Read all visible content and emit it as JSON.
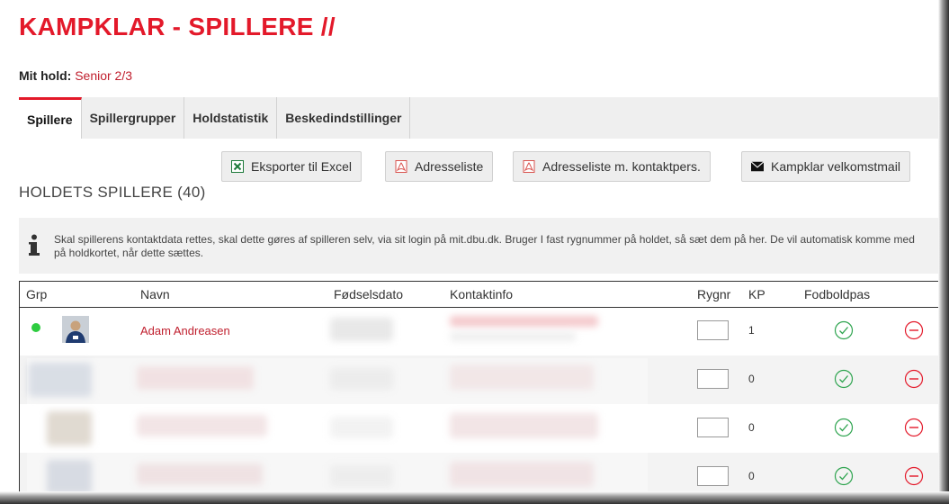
{
  "page_title": "KAMPKLAR - SPILLERE //",
  "my_team": {
    "label": "Mit hold:",
    "value": "Senior 2/3"
  },
  "tabs": [
    {
      "label": "Spillere",
      "active": true
    },
    {
      "label": "Spillergrupper",
      "active": false
    },
    {
      "label": "Holdstatistik",
      "active": false
    },
    {
      "label": "Beskedindstillinger",
      "active": false
    }
  ],
  "actions": {
    "export_excel": {
      "label": "Eksporter til Excel",
      "icon": "excel-icon"
    },
    "address_list": {
      "label": "Adresseliste",
      "icon": "pdf-icon"
    },
    "address_list_contacts": {
      "label": "Adresseliste m. kontaktpers.",
      "icon": "pdf-icon"
    },
    "welcome_mail": {
      "label": "Kampklar velkomstmail",
      "icon": "envelope-icon"
    }
  },
  "section_title": "HOLDETS SPILLERE (40)",
  "info_text": "Skal spillerens kontaktdata rettes, skal dette gøres af spilleren selv, via sit login på mit.dbu.dk. Bruger I fast rygnummer på holdet, så sæt dem på her. De vil automatisk komme med på holdkortet, når dette sættes.",
  "table": {
    "headers": [
      "Grp",
      "Navn",
      "Fødselsdato",
      "Kontaktinfo",
      "Rygnr",
      "KP",
      "Fodboldpas"
    ],
    "rows": [
      {
        "name": "Adam Andreasen",
        "kp": "1",
        "group_active": true
      },
      {
        "name": "",
        "kp": "0",
        "group_active": false
      },
      {
        "name": "",
        "kp": "0",
        "group_active": false
      },
      {
        "name": "",
        "kp": "0",
        "group_active": false
      }
    ]
  },
  "colors": {
    "accent": "#e3192a",
    "link": "#c01f2e",
    "ok": "#2ea44f",
    "remove": "#e3192a"
  }
}
